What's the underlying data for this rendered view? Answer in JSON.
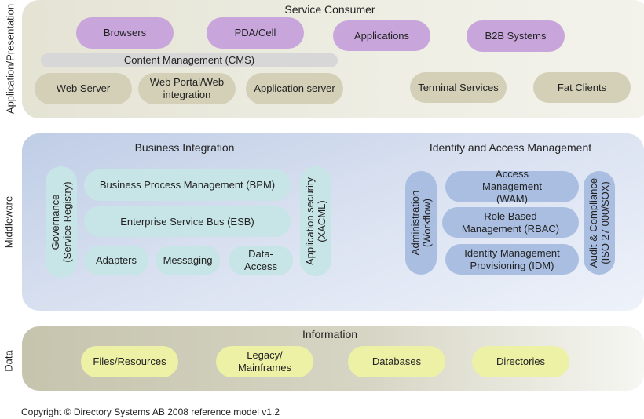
{
  "layers": {
    "presentation": "Application/Presentation",
    "middleware": "Middleware",
    "data": "Data"
  },
  "service_consumer": {
    "title": "Service Consumer",
    "clients": [
      "Browsers",
      "PDA/Cell",
      "Applications",
      "B2B Systems"
    ],
    "cms": "Content Management (CMS)",
    "servers": [
      "Web Server",
      "Web Portal/Web integration",
      "Application server",
      "Terminal Services",
      "Fat Clients"
    ]
  },
  "business_integration": {
    "title": "Business Integration",
    "governance": "Governance (Service Registry)",
    "bpm": "Business Process Management (BPM)",
    "esb": "Enterprise Service Bus (ESB)",
    "adapters": "Adapters",
    "messaging": "Messaging",
    "data_access": "Data-Access",
    "app_security": "Application security (XACML)"
  },
  "iam": {
    "title": "Identity and Access Management",
    "administration": "Administration (Workflow)",
    "access_management": "Access Management (WAM)",
    "role_based": "Role Based Management (RBAC)",
    "identity_management": "Identity Management Provisioning (IDM)",
    "audit": "Audit & Compliance (ISO 27 000/SOX)"
  },
  "information": {
    "title": "Information",
    "items": [
      "Files/Resources",
      "Legacy/ Mainframes",
      "Databases",
      "Directories"
    ]
  },
  "copyright": "Copyright © Directory Systems AB 2008 reference model v1.2",
  "colors": {
    "client": "#c8a6dc",
    "server": "#d3d0b7",
    "integration": "#c7e4e6",
    "iam": "#a9bee1",
    "information": "#edf1a6"
  }
}
